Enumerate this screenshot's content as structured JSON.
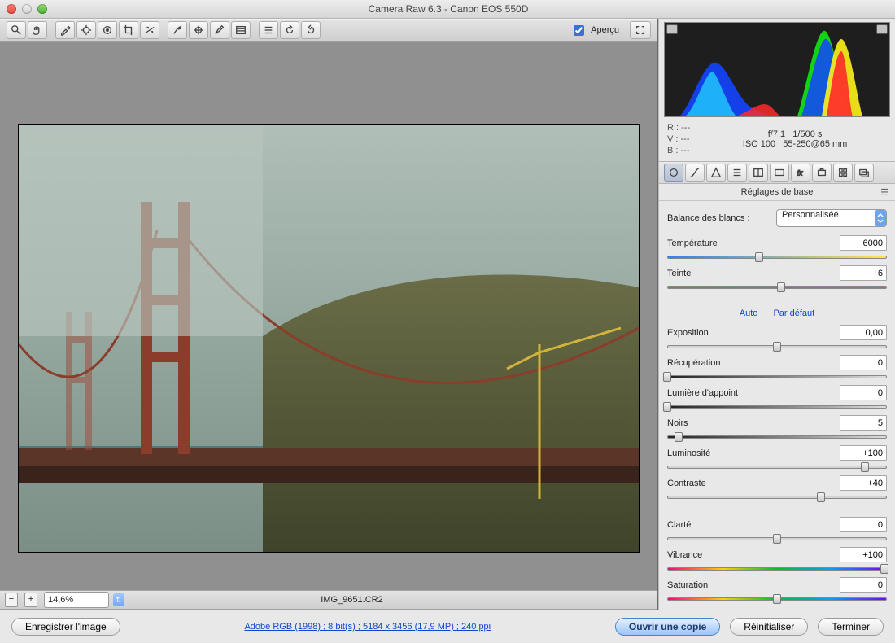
{
  "title": "Camera Raw 6.3  -  Canon EOS 550D",
  "preview_label": "Aperçu",
  "zoom": "14,6%",
  "filename": "IMG_9651.CR2",
  "footer": {
    "save": "Enregistrer l'image",
    "link": "Adobe RGB (1998) ; 8 bit(s) ; 5184 x 3456 (17,9 MP) ; 240 ppi",
    "open": "Ouvrir une copie",
    "reset": "Réinitialiser",
    "done": "Terminer"
  },
  "meta": {
    "r": "R :   ---",
    "g": "V :   ---",
    "b": "B :   ---",
    "aperture": "f/7,1",
    "shutter": "1/500 s",
    "iso": "ISO 100",
    "lens": "55-250@65 mm"
  },
  "panel_title": "Réglages de base",
  "wb": {
    "label": "Balance des blancs :",
    "value": "Personnalisée"
  },
  "sliders": {
    "temperature": {
      "label": "Température",
      "value": "6000",
      "pos": 42,
      "grad": "grad-temp"
    },
    "tint": {
      "label": "Teinte",
      "value": "+6",
      "pos": 52,
      "grad": "grad-tint"
    },
    "auto": "Auto",
    "default": "Par défaut",
    "exposure": {
      "label": "Exposition",
      "value": "0,00",
      "pos": 50,
      "grad": "grad-neutral"
    },
    "recovery": {
      "label": "Récupération",
      "value": "0",
      "pos": 0,
      "grad": "grad-light"
    },
    "fill": {
      "label": "Lumière d'appoint",
      "value": "0",
      "pos": 0,
      "grad": "grad-light"
    },
    "blacks": {
      "label": "Noirs",
      "value": "5",
      "pos": 5,
      "grad": "grad-light"
    },
    "brightness": {
      "label": "Luminosité",
      "value": "+100",
      "pos": 90,
      "grad": "grad-neutral"
    },
    "contrast": {
      "label": "Contraste",
      "value": "+40",
      "pos": 70,
      "grad": "grad-neutral"
    },
    "clarity": {
      "label": "Clarté",
      "value": "0",
      "pos": 50,
      "grad": "grad-neutral"
    },
    "vibrance": {
      "label": "Vibrance",
      "value": "+100",
      "pos": 99,
      "grad": "grad-vib"
    },
    "saturation": {
      "label": "Saturation",
      "value": "0",
      "pos": 50,
      "grad": "grad-vib"
    }
  }
}
